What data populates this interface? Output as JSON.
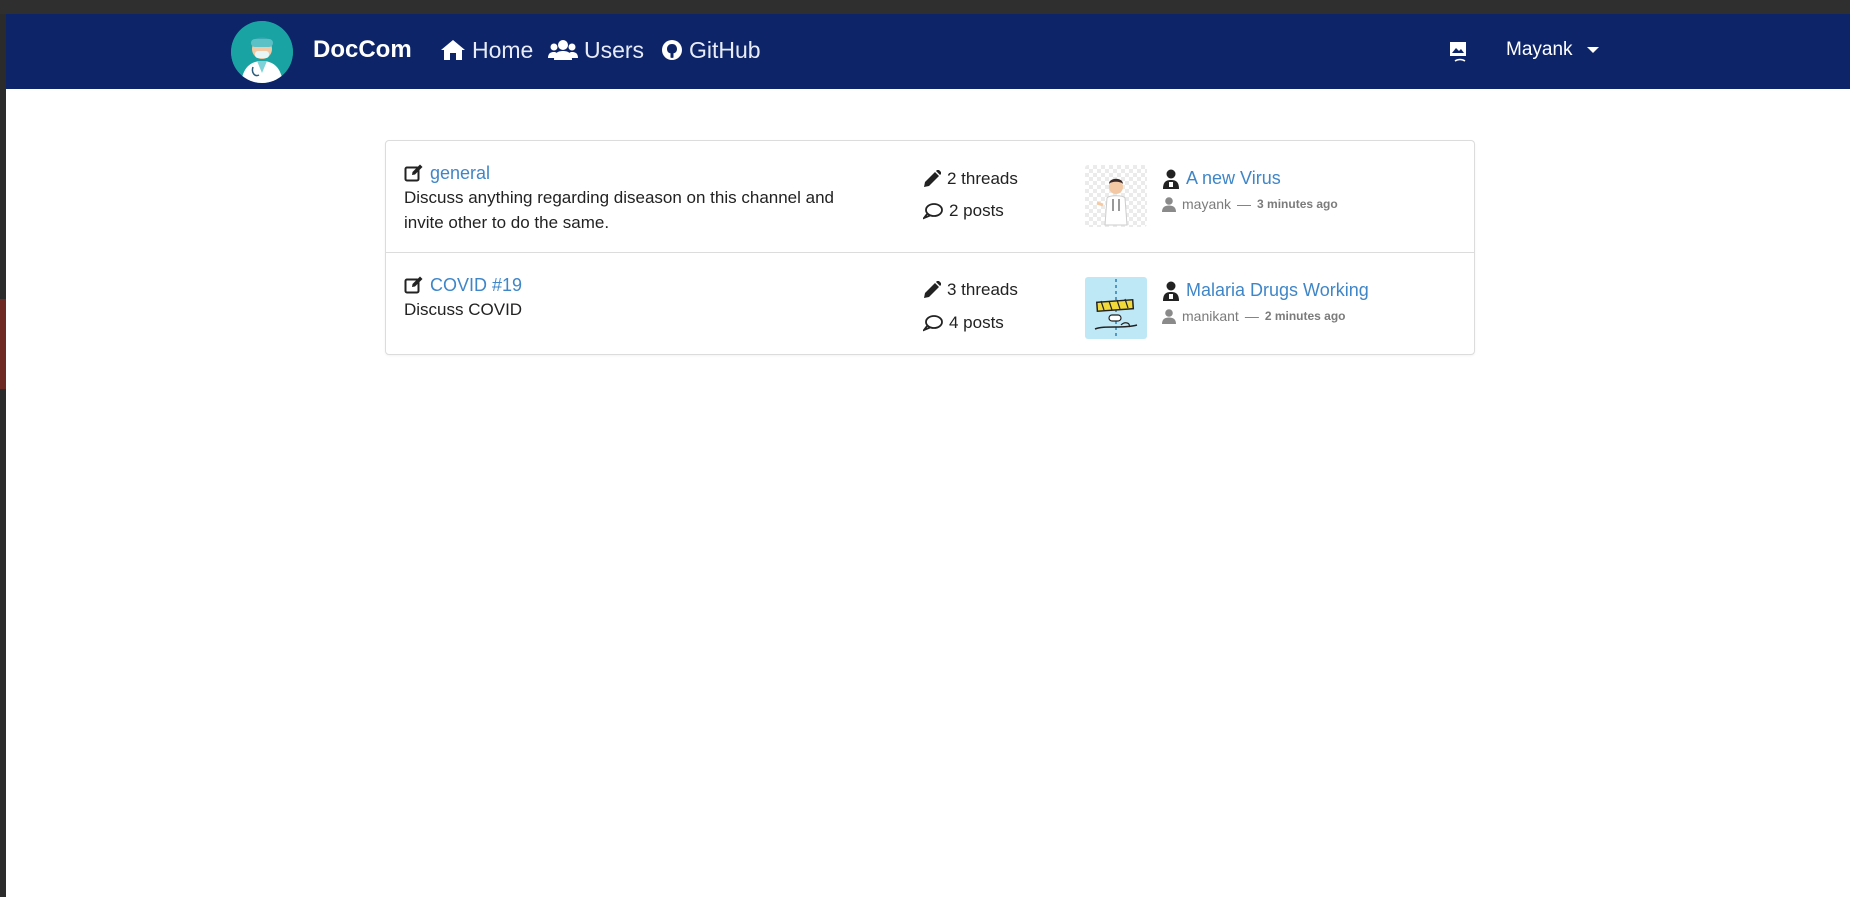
{
  "navbar": {
    "brand": "DocCom",
    "links": [
      {
        "label": "Home",
        "icon": "home-icon"
      },
      {
        "label": "Users",
        "icon": "users-icon"
      },
      {
        "label": "GitHub",
        "icon": "github-icon"
      }
    ],
    "user_name": "Mayank",
    "colors": {
      "bar": "#0d2469",
      "link": "#3f86c8"
    }
  },
  "channels": [
    {
      "name": "general",
      "description": "Discuss anything regarding diseason on this channel and invite other to do the same.",
      "threads": "2 threads",
      "posts": "2 posts",
      "last_thread": {
        "title": "A new Virus",
        "author": "mayank",
        "separator": "—",
        "time": "3 minutes ago"
      }
    },
    {
      "name": "COVID #19",
      "description": "Discuss COVID",
      "threads": "3 threads",
      "posts": "4 posts",
      "last_thread": {
        "title": "Malaria Drugs Working",
        "author": "manikant",
        "separator": "—",
        "time": "2 minutes ago"
      }
    }
  ]
}
